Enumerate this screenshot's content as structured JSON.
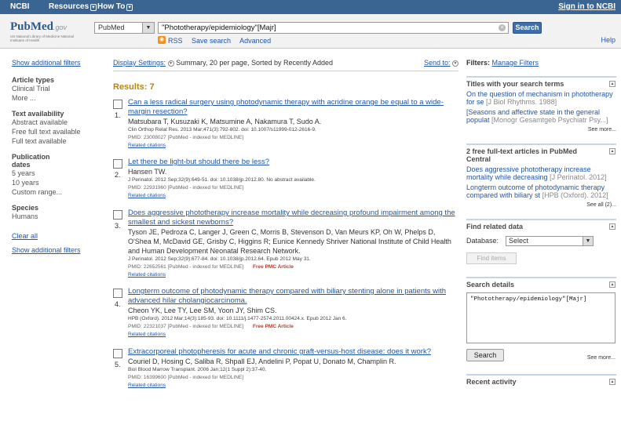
{
  "topbar": {
    "ncbi": "NCBI",
    "resources": "Resources",
    "howto": "How To",
    "signin": "Sign in to NCBI"
  },
  "header": {
    "logo_main": "PubMed",
    "logo_gov": ".gov",
    "logo_sub": "US National Library of Medicine National Institutes of Health",
    "db_value": "PubMed",
    "term_value": "\"Phototherapy/epidemiology\"[Majr]",
    "search_label": "Search",
    "rss": "RSS",
    "save_search": "Save search",
    "advanced": "Advanced",
    "help": "Help"
  },
  "left": {
    "show_filters": "Show additional filters",
    "article_types": "Article types",
    "clinical_trial": "Clinical Trial",
    "more": "More ...",
    "text_availability": "Text availability",
    "abstract_available": "Abstract available",
    "free_full_text": "Free full text available",
    "full_text": "Full text available",
    "pub_dates": "Publication dates",
    "five_years": "5 years",
    "ten_years": "10 years",
    "custom_range": "Custom range...",
    "species": "Species",
    "humans": "Humans",
    "clear_all": "Clear all",
    "show_filters2": "Show additional filters"
  },
  "center": {
    "display_settings": "Display Settings:",
    "display_value": "Summary, 20 per page, Sorted by Recently Added",
    "send_to": "Send to:",
    "results": "Results: 7",
    "articles": [
      {
        "num": "1.",
        "title": "Can a less radical surgery using photodynamic therapy with acridine orange be equal to a wide-margin resection?",
        "authors": "Matsubara T, Kusuzaki K, Matsumine A, Nakamura T, Sudo A.",
        "journal": "Clin Orthop Relat Res. 2013 Mar;471(3):792-802. doi: 10.1007/s11999-012-2616-9.",
        "pmid": "PMID: 23008027 [PubMed - indexed for MEDLINE]",
        "pmc": "",
        "related": "Related citations"
      },
      {
        "num": "2.",
        "title": "Let there be light-but should there be less?",
        "authors": "Hansen TW.",
        "journal": "J Perinatol. 2012 Sep;32(9):649-51. doi: 10.1038/jp.2012.80. No abstract available.",
        "pmid": "PMID: 22931960 [PubMed - indexed for MEDLINE]",
        "pmc": "",
        "related": "Related citations"
      },
      {
        "num": "3.",
        "title": "Does aggressive phototherapy increase mortality while decreasing profound impairment among the smallest and sickest newborns?",
        "authors": "Tyson JE, Pedroza C, Langer J, Green C, Morris B, Stevenson D, Van Meurs KP, Oh W, Phelps D, O'Shea M, McDavid GE, Grisby C, Higgins R; Eunice Kennedy Shriver National Institute of Child Health and Human Development Neonatal Research Network.",
        "journal": "J Perinatol. 2012 Sep;32(9):677-84. doi: 10.1038/jp.2012.64. Epub 2012 May 31.",
        "pmid": "PMID: 22652561 [PubMed - indexed for MEDLINE]",
        "pmc": "Free PMC Article",
        "related": "Related citations"
      },
      {
        "num": "4.",
        "title": "Longterm outcome of photodynamic therapy compared with biliary stenting alone in patients with advanced hilar cholangiocarcinoma.",
        "authors": "Cheon YK, Lee TY, Lee SM, Yoon JY, Shim CS.",
        "journal": "HPB (Oxford). 2012 Mar;14(3):185-93. doi: 10.1111/j.1477-2574.2011.00424.x. Epub 2012 Jan 6.",
        "pmid": "PMID: 22321037 [PubMed - indexed for MEDLINE]",
        "pmc": "Free PMC Article",
        "related": "Related citations"
      },
      {
        "num": "5.",
        "title": "Extracorporeal photopheresis for acute and chronic graft-versus-host disease: does it work?",
        "authors": "Couriel D, Hosing C, Saliba R, Shpall EJ, Andelini P, Popat U, Donato M, Champlin R.",
        "journal": "Biol Blood Marrow Transplant. 2006 Jan;12(1 Suppl 2):37-40.",
        "pmid": "PMID: 16399600 [PubMed - indexed for MEDLINE]",
        "pmc": "",
        "related": "Related citations"
      }
    ]
  },
  "right": {
    "filters_label": "Filters:",
    "manage_filters": "Manage Filters",
    "titles_header": "Titles with your search terms",
    "t1_text": "On the question of mechanism in phototherapy for se",
    "t1_src": "[J Biol Rhythms. 1988]",
    "t2_text": "[Seasons and affective state in the general populat",
    "t2_src": "[Monogr Gesamtgeb Psychiatr Psy...]",
    "see_more": "See more...",
    "free_header": "2 free full-text articles in PubMed Central",
    "f1_text": "Does aggressive phototherapy increase mortality while decreasing",
    "f1_src": "[J Perinatol. 2012]",
    "f2_text": "Longterm outcome of photodynamic therapy compared with biliary st",
    "f2_src": "[HPB (Oxford). 2012]",
    "see_all": "See all (2)...",
    "find_related": "Find related data",
    "database_label": "Database:",
    "database_value": "Select",
    "find_items": "Find items",
    "search_details": "Search details",
    "details_text": "\"Phototherapy/epidemiology\"[Majr]",
    "search_btn": "Search",
    "see_more2": "See more...",
    "recent_activity": "Recent activity"
  }
}
